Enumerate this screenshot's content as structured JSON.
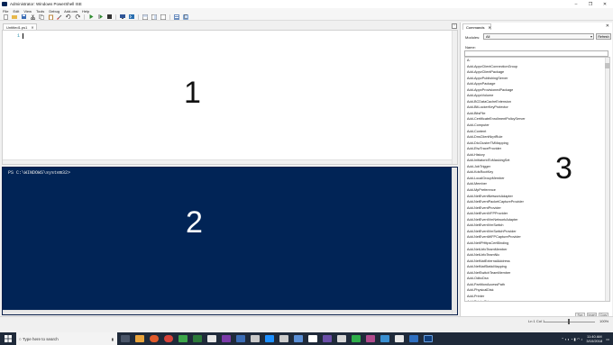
{
  "window": {
    "title": "Administrator: Windows PowerShell ISE"
  },
  "window_controls": {
    "minimize": "–",
    "maximize": "❐",
    "close": "✕"
  },
  "menu": [
    "File",
    "Edit",
    "View",
    "Tools",
    "Debug",
    "Add-ons",
    "Help"
  ],
  "toolbar": {
    "icons": [
      "new-script-icon",
      "open-icon",
      "save-icon",
      "cut-icon",
      "copy-icon",
      "paste-icon",
      "clear-icon",
      "undo-icon",
      "redo-icon",
      "run-icon",
      "run-selection-icon",
      "stop-icon",
      "remote-tab-icon",
      "start-powershell-icon",
      "show-script-pane-top-icon",
      "show-script-pane-right-icon",
      "show-script-pane-max-icon",
      "show-commands-icon",
      "show-addon-icon"
    ]
  },
  "editor": {
    "tab_label": "Untitled1.ps1",
    "tab_close": "✕",
    "line_number": "1",
    "region_label": "1"
  },
  "console": {
    "prompt": "PS C:\\WINDOWS\\system32> ",
    "region_label": "2"
  },
  "status": {
    "position": "Ln 1  Col 1",
    "zoom": "100%"
  },
  "commands": {
    "tab_label": "Commands",
    "tab_close": "✕",
    "panel_close": "✕",
    "modules_label": "Modules:",
    "modules_value": "All",
    "refresh_label": "Refresh",
    "name_label": "Name:",
    "region_label": "3",
    "items": [
      "A:",
      "Add-AppvClientConnectionGroup",
      "Add-AppvClientPackage",
      "Add-AppvPublishingServer",
      "Add-AppxPackage",
      "Add-AppxProvisionedPackage",
      "Add-AppxVolume",
      "Add-BCDataCacheExtension",
      "Add-BitLockerKeyProtector",
      "Add-BitsFile",
      "Add-CertificateEnrollmentPolicyServer",
      "Add-Computer",
      "Add-Content",
      "Add-DnsClientNrptRule",
      "Add-DtcClusterTMMapping",
      "Add-EtwTraceProvider",
      "Add-History",
      "Add-InitiatorIdToMaskingSet",
      "Add-JobTrigger",
      "Add-KdsRootKey",
      "Add-LocalGroupMember",
      "Add-Member",
      "Add-MpPreference",
      "Add-NetEventNetworkAdapter",
      "Add-NetEventPacketCaptureProvider",
      "Add-NetEventProvider",
      "Add-NetEventVFPProvider",
      "Add-NetEventVmNetworkAdapter",
      "Add-NetEventVmSwitch",
      "Add-NetEventVmSwitchProvider",
      "Add-NetEventWFPCaptureProvider",
      "Add-NetIPHttpsCertBinding",
      "Add-NetLbfoTeamMember",
      "Add-NetLbfoTeamNic",
      "Add-NetNatExternalAddress",
      "Add-NetNatStaticMapping",
      "Add-NetSwitchTeamMember",
      "Add-OdbcDsn",
      "Add-PartitionAccessPath",
      "Add-PhysicalDisk",
      "Add-Printer",
      "Add-PrinterDriver"
    ],
    "buttons": [
      "Run",
      "Insert",
      "Copy"
    ]
  },
  "taskbar": {
    "search_placeholder": "Type here to search",
    "time": "11:40 AM",
    "date": "3/10/2018"
  }
}
